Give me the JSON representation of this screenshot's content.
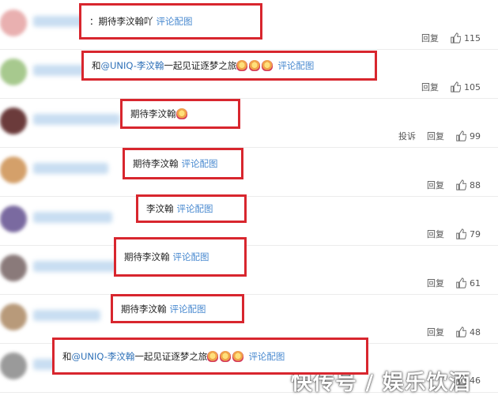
{
  "comments": [
    {
      "parts": [
        {
          "t": "txt",
          "v": "："
        },
        {
          "t": "txt",
          "v": "期待李汶翰吖"
        },
        {
          "t": "link",
          "v": "评论配图"
        }
      ],
      "actions": [
        "回复"
      ],
      "likes": "115",
      "avatar_color": "#e9b0b0"
    },
    {
      "parts": [
        {
          "t": "txt",
          "v": "和"
        },
        {
          "t": "mention",
          "v": "@UNIQ-李汶翰"
        },
        {
          "t": "txt",
          "v": " 一起见证逐梦之旅"
        },
        {
          "t": "emo"
        },
        {
          "t": "emo"
        },
        {
          "t": "emo"
        },
        {
          "t": "link",
          "v": "评论配图"
        }
      ],
      "actions": [
        "回复"
      ],
      "likes": "105",
      "avatar_color": "#a7c98e"
    },
    {
      "parts": [
        {
          "t": "txt",
          "v": "期待李汶翰"
        },
        {
          "t": "emo"
        }
      ],
      "actions": [
        "投诉",
        "回复"
      ],
      "likes": "99",
      "avatar_color": "#6b3b3b"
    },
    {
      "parts": [
        {
          "t": "txt",
          "v": "期待李汶翰"
        },
        {
          "t": "link",
          "v": "评论配图"
        }
      ],
      "actions": [
        "回复"
      ],
      "likes": "88",
      "avatar_color": "#d4a06a"
    },
    {
      "parts": [
        {
          "t": "txt",
          "v": "李汶翰"
        },
        {
          "t": "link",
          "v": "评论配图"
        }
      ],
      "actions": [
        "回复"
      ],
      "likes": "79",
      "avatar_color": "#7a6aa0"
    },
    {
      "parts": [
        {
          "t": "txt",
          "v": "期待李汶翰"
        },
        {
          "t": "link",
          "v": "评论配图"
        }
      ],
      "actions": [
        "回复"
      ],
      "likes": "61",
      "avatar_color": "#8a7a7a"
    },
    {
      "parts": [
        {
          "t": "txt",
          "v": "期待李汶翰"
        },
        {
          "t": "link",
          "v": "评论配图"
        }
      ],
      "actions": [
        "回复"
      ],
      "likes": "48",
      "avatar_color": "#b89a7a"
    },
    {
      "parts": [
        {
          "t": "txt",
          "v": "和"
        },
        {
          "t": "mention",
          "v": "@UNIQ-李汶翰"
        },
        {
          "t": "txt",
          "v": " 一起见证逐梦之旅"
        },
        {
          "t": "emo"
        },
        {
          "t": "emo"
        },
        {
          "t": "emo"
        },
        {
          "t": "link",
          "v": "评论配图"
        }
      ],
      "actions": [],
      "likes": "46",
      "avatar_color": "#9a9a9a"
    }
  ],
  "watermark": "快传号 / 娱乐饮酒",
  "icons": {
    "like": "thumbs-up-icon",
    "emoji": "sticker-emoji-icon"
  }
}
